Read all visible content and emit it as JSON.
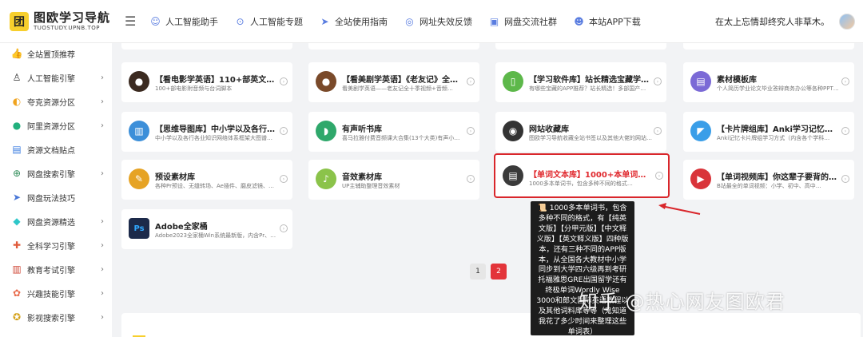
{
  "header": {
    "logo_mark": "团",
    "logo_title": "图欧学习导航",
    "logo_sub": "TUOSTUDY.UPNB.TOP",
    "menu_icon": "menu-icon",
    "nav": [
      {
        "label": "人工智能助手",
        "icon": "☺"
      },
      {
        "label": "人工智能专题",
        "icon": "⊙"
      },
      {
        "label": "全站使用指南",
        "icon": "➤"
      },
      {
        "label": "网址失效反馈",
        "icon": "◎"
      },
      {
        "label": "网盘交流社群",
        "icon": "▣"
      },
      {
        "label": "本站APP下载",
        "icon": "☻"
      }
    ],
    "motto": "在太上忘情却终究人非草木。"
  },
  "sidebar": {
    "items": [
      {
        "label": "全站置顶推荐",
        "icon": "👍",
        "chevron": false
      },
      {
        "label": "人工智能引擎",
        "icon": "♙",
        "chevron": true
      },
      {
        "label": "夸克资源分区",
        "icon": "◐",
        "chevron": true
      },
      {
        "label": "阿里资源分区",
        "icon": "●",
        "chevron": true
      },
      {
        "label": "资源文档贴点",
        "icon": "▤",
        "chevron": false
      },
      {
        "label": "网盘搜索引擎",
        "icon": "⊕",
        "chevron": true
      },
      {
        "label": "网盘玩法技巧",
        "icon": "➤",
        "chevron": false
      },
      {
        "label": "网盘资源精选",
        "icon": "◆",
        "chevron": true
      },
      {
        "label": "全科学习引擎",
        "icon": "✚",
        "chevron": true
      },
      {
        "label": "教育考试引擎",
        "icon": "▥",
        "chevron": true
      },
      {
        "label": "兴趣技能引擎",
        "icon": "✿",
        "chevron": true
      },
      {
        "label": "影视搜索引擎",
        "icon": "✪",
        "chevron": true
      }
    ]
  },
  "cards": [
    {
      "title": "【看电影学英语】110+部英文动画电…",
      "desc": "100+部电影附音频与台词脚本",
      "thumb": "●",
      "color": "#3b2a20"
    },
    {
      "title": "【看美剧学英语】《老友记》全十季 …",
      "desc": "看美剧学英语——老友记全十季视频+音频…",
      "thumb": "●",
      "color": "#7a4a2a"
    },
    {
      "title": "【学习软件库】站长精选宝藏学习APP…",
      "desc": "有哪些宝藏的APP推荐？站长精选！多部国产…",
      "thumb": "▯",
      "color": "#5db84a"
    },
    {
      "title": "素材模板库",
      "desc": "个人简历学业论文毕业答辩商务办公等各种PPT…",
      "thumb": "▤",
      "color": "#7b6ad6"
    },
    {
      "title": "【思维导图库】中小学以及各行各业知…",
      "desc": "中小学以及各行各业知识网络体系框架大图谱…",
      "thumb": "▥",
      "color": "#3c8fd9"
    },
    {
      "title": "有声听书库",
      "desc": "喜马拉雅付费音频课大合集(13个大类)有声小…",
      "thumb": "◗",
      "color": "#2fa86b"
    },
    {
      "title": "网站收藏库",
      "desc": "图欧学习导航收藏全站书签以及其他大佬的网站…",
      "thumb": "◉",
      "color": "#333333"
    },
    {
      "title": "【卡片牌组库】Anki学习记忆卡片牌组…",
      "desc": "Anki记忆卡片牌组学习方式（内含各个学科…",
      "thumb": "◤",
      "color": "#3a9ee8"
    },
    {
      "title": "预设素材库",
      "desc": "各种Pr预设、无缝转场、Ae插件、磨皮滤镜、…",
      "thumb": "✎",
      "color": "#e6a324"
    },
    {
      "title": "音效素材库",
      "desc": "UP主辅助整理音效素材",
      "thumb": "♪",
      "color": "#8bc34a"
    },
    {
      "title": "【单词文本库】1000+本单词表，多格…",
      "desc": "1000多本单词书，包含多种不同的格式…",
      "thumb": "▤",
      "color": "#3a3a3a",
      "prefix": "📜"
    },
    {
      "title": "【单词视频库】你这辈子要背的单词都…",
      "desc": "B站最全的单词视频：小学、初中、高中…",
      "thumb": "▶",
      "color": "#d9343a",
      "prefix": "⚪"
    },
    {
      "title": "Adobe全家桶",
      "desc": "Adobe2023全家桶Win系统最新版，内含Pr、…",
      "thumb": "Ps",
      "color": "#1c2a4a"
    }
  ],
  "pagination": {
    "pages": [
      "1",
      "2"
    ],
    "current": "2"
  },
  "tooltip": {
    "text": "📜 1000多本单词书，包含多种不同的格式，有【纯英文版】【分甲元版】【中文释义版】【英文释义版】四种版本，还有三种不同的APP版本，从全国各大教材中小学同步到大学四六级再到考研托福雅思GRE出国留学还有终极单词Wordly Wise 3000和郎文国际英语教程以及其他词料库等等（鬼知道我花了多少时间来整理这些单词表）"
  },
  "watermark": "知乎 @热心网友图欧君"
}
